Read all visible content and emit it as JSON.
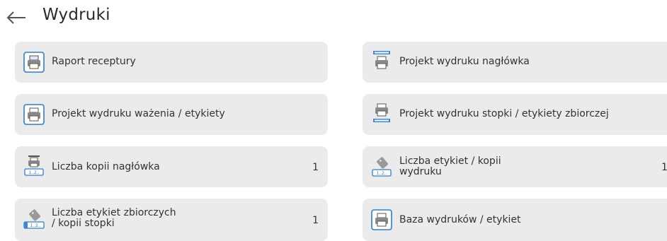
{
  "header": {
    "title": "Wydruki",
    "back_icon": "back-arrow-icon"
  },
  "colors": {
    "tile_background": "#ebebeb",
    "icon_accent": "#3a86d8",
    "icon_frame": "#2f7ed0",
    "text": "#333333"
  },
  "tiles": [
    {
      "label": "Raport receptury",
      "value": "",
      "icon": "print-report-icon"
    },
    {
      "label": "Projekt wydruku nagłówka",
      "value": "",
      "icon": "header-print-icon"
    },
    {
      "label": "Projekt wydruku ważenia / etykiety",
      "value": "",
      "icon": "weighing-print-icon"
    },
    {
      "label": "Projekt wydruku stopki / etykiety zbiorczej",
      "value": "",
      "icon": "footer-print-icon"
    },
    {
      "label": "Liczba kopii nagłówka",
      "value": "1",
      "icon": "header-copies-icon"
    },
    {
      "label_line1": "Liczba etykiet / kopii",
      "label_line2": "wydruku",
      "value": "1",
      "icon": "label-copies-icon"
    },
    {
      "label_line1": "Liczba etykiet zbiorczych",
      "label_line2": "/ kopii stopki",
      "value": "1",
      "icon": "collective-label-copies-icon"
    },
    {
      "label": "Baza wydruków / etykiet",
      "value": "",
      "icon": "print-database-icon"
    }
  ]
}
